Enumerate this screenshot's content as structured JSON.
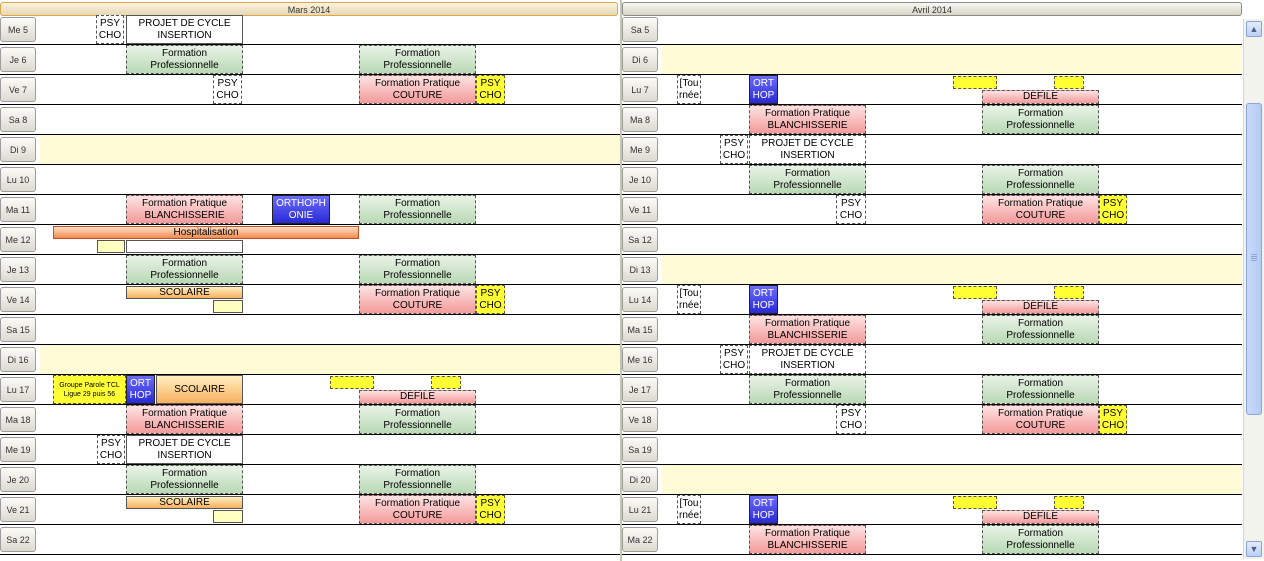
{
  "left": {
    "month": "Mars 2014",
    "rows": [
      {
        "day": "Me 5",
        "sunday": false,
        "events": [
          {
            "type": "white",
            "l": 56,
            "w": 28,
            "text": [
              "PSY",
              "CHO"
            ]
          },
          {
            "type": "plain",
            "l": 86,
            "w": 117,
            "text": [
              "PROJET DE CYCLE",
              "INSERTION"
            ]
          }
        ]
      },
      {
        "day": "Je 6",
        "sunday": false,
        "events": [
          {
            "type": "green",
            "l": 86,
            "w": 117,
            "text": [
              "Formation",
              "Professionnelle"
            ]
          },
          {
            "type": "green",
            "l": 319,
            "w": 117,
            "text": [
              "Formation",
              "Professionnelle"
            ]
          }
        ]
      },
      {
        "day": "Ve 7",
        "sunday": false,
        "events": [
          {
            "type": "white",
            "l": 173,
            "w": 29,
            "text": [
              "PSY",
              "CHO"
            ]
          },
          {
            "type": "red",
            "l": 319,
            "w": 117,
            "text": [
              "Formation Pratique",
              "COUTURE"
            ]
          },
          {
            "type": "yellow",
            "l": 436,
            "w": 29,
            "text": [
              "PSY",
              "CHO"
            ]
          }
        ]
      },
      {
        "day": "Sa 8",
        "sunday": false,
        "events": []
      },
      {
        "day": "Di 9",
        "sunday": true,
        "events": []
      },
      {
        "day": "Lu 10",
        "sunday": false,
        "events": []
      },
      {
        "day": "Ma 11",
        "sunday": false,
        "events": [
          {
            "type": "red",
            "l": 86,
            "w": 117,
            "text": [
              "Formation Pratique",
              "BLANCHISSERIE"
            ]
          },
          {
            "type": "blue",
            "l": 232,
            "w": 58,
            "text": [
              "ORTHOPH",
              "ONIE"
            ]
          },
          {
            "type": "green",
            "l": 319,
            "w": 117,
            "text": [
              "Formation",
              "Professionnelle"
            ]
          }
        ]
      },
      {
        "day": "Me 12",
        "sunday": false,
        "events": [
          {
            "type": "hosp",
            "l": 13,
            "w": 306,
            "t": 1,
            "h": 13,
            "text": [
              "Hospitalisation"
            ]
          },
          {
            "type": "lightyellow",
            "l": 57,
            "w": 28,
            "t": 15,
            "h": 13,
            "text": [
              ""
            ]
          },
          {
            "type": "plain",
            "l": 86,
            "w": 117,
            "t": 15,
            "h": 13,
            "text": [
              ""
            ]
          }
        ]
      },
      {
        "day": "Je 13",
        "sunday": false,
        "events": [
          {
            "type": "green",
            "l": 86,
            "w": 117,
            "text": [
              "Formation",
              "Professionnelle"
            ]
          },
          {
            "type": "green",
            "l": 319,
            "w": 117,
            "text": [
              "Formation",
              "Professionnelle"
            ]
          }
        ]
      },
      {
        "day": "Ve 14",
        "sunday": false,
        "events": [
          {
            "type": "orange",
            "l": 86,
            "w": 117,
            "t": 1,
            "h": 13,
            "text": [
              "SCOLAIRE"
            ]
          },
          {
            "type": "lightyellow",
            "l": 173,
            "w": 30,
            "t": 15,
            "h": 13,
            "text": [
              ""
            ]
          },
          {
            "type": "red",
            "l": 319,
            "w": 117,
            "text": [
              "Formation Pratique",
              "COUTURE"
            ]
          },
          {
            "type": "yellow",
            "l": 436,
            "w": 29,
            "text": [
              "PSY",
              "CHO"
            ]
          }
        ]
      },
      {
        "day": "Sa 15",
        "sunday": false,
        "events": []
      },
      {
        "day": "Di 16",
        "sunday": true,
        "events": []
      },
      {
        "day": "Lu 17",
        "sunday": false,
        "events": [
          {
            "type": "yellow",
            "l": 13,
            "w": 73,
            "small": true,
            "text": [
              "Groupe Parole TCL",
              "Ligue 29 puis 56"
            ]
          },
          {
            "type": "blue",
            "l": 86,
            "w": 29,
            "text": [
              "ORT",
              "HOP"
            ]
          },
          {
            "type": "orange",
            "l": 116,
            "w": 87,
            "text": [
              "SCOLAIRE"
            ]
          },
          {
            "type": "yellow",
            "l": 290,
            "w": 44,
            "t": 1,
            "h": 13,
            "text": [
              ""
            ]
          },
          {
            "type": "yellow",
            "l": 391,
            "w": 30,
            "t": 1,
            "h": 13,
            "text": [
              ""
            ]
          },
          {
            "type": "red",
            "l": 319,
            "w": 117,
            "t": 15,
            "h": 14,
            "text": [
              "DEFILE"
            ]
          }
        ]
      },
      {
        "day": "Ma 18",
        "sunday": false,
        "events": [
          {
            "type": "red",
            "l": 86,
            "w": 117,
            "text": [
              "Formation Pratique",
              "BLANCHISSERIE"
            ]
          },
          {
            "type": "green",
            "l": 319,
            "w": 117,
            "text": [
              "Formation",
              "Professionnelle"
            ]
          }
        ]
      },
      {
        "day": "Me 19",
        "sunday": false,
        "events": [
          {
            "type": "white",
            "l": 57,
            "w": 28,
            "text": [
              "PSY",
              "CHO"
            ]
          },
          {
            "type": "plain",
            "l": 86,
            "w": 117,
            "text": [
              "PROJET DE CYCLE",
              "INSERTION"
            ]
          }
        ]
      },
      {
        "day": "Je 20",
        "sunday": false,
        "events": [
          {
            "type": "green",
            "l": 86,
            "w": 117,
            "text": [
              "Formation",
              "Professionnelle"
            ]
          },
          {
            "type": "green",
            "l": 319,
            "w": 117,
            "text": [
              "Formation",
              "Professionnelle"
            ]
          }
        ]
      },
      {
        "day": "Ve 21",
        "sunday": false,
        "events": [
          {
            "type": "orange",
            "l": 86,
            "w": 117,
            "t": 1,
            "h": 13,
            "text": [
              "SCOLAIRE"
            ]
          },
          {
            "type": "lightyellow",
            "l": 173,
            "w": 30,
            "t": 15,
            "h": 13,
            "text": [
              ""
            ]
          },
          {
            "type": "red",
            "l": 319,
            "w": 117,
            "text": [
              "Formation Pratique",
              "COUTURE"
            ]
          },
          {
            "type": "yellow",
            "l": 436,
            "w": 29,
            "text": [
              "PSY",
              "CHO"
            ]
          }
        ]
      },
      {
        "day": "Sa 22",
        "sunday": false,
        "events": []
      }
    ]
  },
  "right": {
    "month": "Avril 2014",
    "rows": [
      {
        "day": "Sa 5",
        "sunday": false,
        "events": []
      },
      {
        "day": "Di 6",
        "sunday": true,
        "events": []
      },
      {
        "day": "Lu 7",
        "sunday": false,
        "events": [
          {
            "type": "white",
            "l": 15,
            "w": 24,
            "text": [
              "[Tou",
              "rnée"
            ]
          },
          {
            "type": "blue",
            "l": 87,
            "w": 29,
            "text": [
              "ORT",
              "HOP"
            ]
          },
          {
            "type": "yellow",
            "l": 291,
            "w": 44,
            "t": 1,
            "h": 13,
            "text": [
              ""
            ]
          },
          {
            "type": "yellow",
            "l": 392,
            "w": 30,
            "t": 1,
            "h": 13,
            "text": [
              ""
            ]
          },
          {
            "type": "red",
            "l": 320,
            "w": 117,
            "t": 15,
            "h": 14,
            "text": [
              "DEFILE"
            ]
          }
        ]
      },
      {
        "day": "Ma 8",
        "sunday": false,
        "events": [
          {
            "type": "red",
            "l": 87,
            "w": 117,
            "text": [
              "Formation Pratique",
              "BLANCHISSERIE"
            ]
          },
          {
            "type": "green",
            "l": 320,
            "w": 117,
            "text": [
              "Formation",
              "Professionnelle"
            ]
          }
        ]
      },
      {
        "day": "Me 9",
        "sunday": false,
        "events": [
          {
            "type": "white",
            "l": 58,
            "w": 28,
            "text": [
              "PSY",
              "CHO"
            ]
          },
          {
            "type": "white",
            "l": 87,
            "w": 117,
            "text": [
              "PROJET DE CYCLE",
              "INSERTION"
            ]
          }
        ]
      },
      {
        "day": "Je 10",
        "sunday": false,
        "events": [
          {
            "type": "green",
            "l": 87,
            "w": 117,
            "text": [
              "Formation",
              "Professionnelle"
            ]
          },
          {
            "type": "green",
            "l": 320,
            "w": 117,
            "text": [
              "Formation",
              "Professionnelle"
            ]
          }
        ]
      },
      {
        "day": "Ve 11",
        "sunday": false,
        "events": [
          {
            "type": "white",
            "l": 174,
            "w": 30,
            "text": [
              "PSY",
              "CHO"
            ]
          },
          {
            "type": "red",
            "l": 320,
            "w": 117,
            "text": [
              "Formation Pratique",
              "COUTURE"
            ]
          },
          {
            "type": "yellow",
            "l": 437,
            "w": 28,
            "text": [
              "PSY",
              "CHO"
            ]
          }
        ]
      },
      {
        "day": "Sa 12",
        "sunday": false,
        "events": []
      },
      {
        "day": "Di 13",
        "sunday": true,
        "events": []
      },
      {
        "day": "Lu 14",
        "sunday": false,
        "events": [
          {
            "type": "white",
            "l": 15,
            "w": 24,
            "text": [
              "[Tou",
              "rnée"
            ]
          },
          {
            "type": "blue",
            "l": 87,
            "w": 29,
            "text": [
              "ORT",
              "HOP"
            ]
          },
          {
            "type": "yellow",
            "l": 291,
            "w": 44,
            "t": 1,
            "h": 13,
            "text": [
              ""
            ]
          },
          {
            "type": "yellow",
            "l": 392,
            "w": 30,
            "t": 1,
            "h": 13,
            "text": [
              ""
            ]
          },
          {
            "type": "red",
            "l": 320,
            "w": 117,
            "t": 15,
            "h": 14,
            "text": [
              "DEFILE"
            ]
          }
        ]
      },
      {
        "day": "Ma 15",
        "sunday": false,
        "events": [
          {
            "type": "red",
            "l": 87,
            "w": 117,
            "text": [
              "Formation Pratique",
              "BLANCHISSERIE"
            ]
          },
          {
            "type": "green",
            "l": 320,
            "w": 117,
            "text": [
              "Formation",
              "Professionnelle"
            ]
          }
        ]
      },
      {
        "day": "Me 16",
        "sunday": false,
        "events": [
          {
            "type": "white",
            "l": 58,
            "w": 28,
            "text": [
              "PSY",
              "CHO"
            ]
          },
          {
            "type": "white",
            "l": 87,
            "w": 117,
            "text": [
              "PROJET DE CYCLE",
              "INSERTION"
            ]
          }
        ]
      },
      {
        "day": "Je 17",
        "sunday": false,
        "events": [
          {
            "type": "green",
            "l": 87,
            "w": 117,
            "text": [
              "Formation",
              "Professionnelle"
            ]
          },
          {
            "type": "green",
            "l": 320,
            "w": 117,
            "text": [
              "Formation",
              "Professionnelle"
            ]
          }
        ]
      },
      {
        "day": "Ve 18",
        "sunday": false,
        "events": [
          {
            "type": "white",
            "l": 174,
            "w": 30,
            "text": [
              "PSY",
              "CHO"
            ]
          },
          {
            "type": "red",
            "l": 320,
            "w": 117,
            "text": [
              "Formation Pratique",
              "COUTURE"
            ]
          },
          {
            "type": "yellow",
            "l": 437,
            "w": 28,
            "text": [
              "PSY",
              "CHO"
            ]
          }
        ]
      },
      {
        "day": "Sa 19",
        "sunday": false,
        "events": []
      },
      {
        "day": "Di 20",
        "sunday": true,
        "events": []
      },
      {
        "day": "Lu 21",
        "sunday": false,
        "events": [
          {
            "type": "white",
            "l": 15,
            "w": 24,
            "text": [
              "[Tou",
              "rnée"
            ]
          },
          {
            "type": "blue",
            "l": 87,
            "w": 29,
            "text": [
              "ORT",
              "HOP"
            ]
          },
          {
            "type": "yellow",
            "l": 291,
            "w": 44,
            "t": 1,
            "h": 13,
            "text": [
              ""
            ]
          },
          {
            "type": "yellow",
            "l": 392,
            "w": 30,
            "t": 1,
            "h": 13,
            "text": [
              ""
            ]
          },
          {
            "type": "red",
            "l": 320,
            "w": 117,
            "t": 15,
            "h": 14,
            "text": [
              "DEFILE"
            ]
          }
        ]
      },
      {
        "day": "Ma 22",
        "sunday": false,
        "events": [
          {
            "type": "red",
            "l": 87,
            "w": 117,
            "text": [
              "Formation Pratique",
              "BLANCHISSERIE"
            ]
          },
          {
            "type": "green",
            "l": 320,
            "w": 117,
            "text": [
              "Formation",
              "Professionnelle"
            ]
          }
        ]
      }
    ]
  },
  "scrollbar": {
    "up_icon": "▲",
    "down_icon": "▼"
  }
}
